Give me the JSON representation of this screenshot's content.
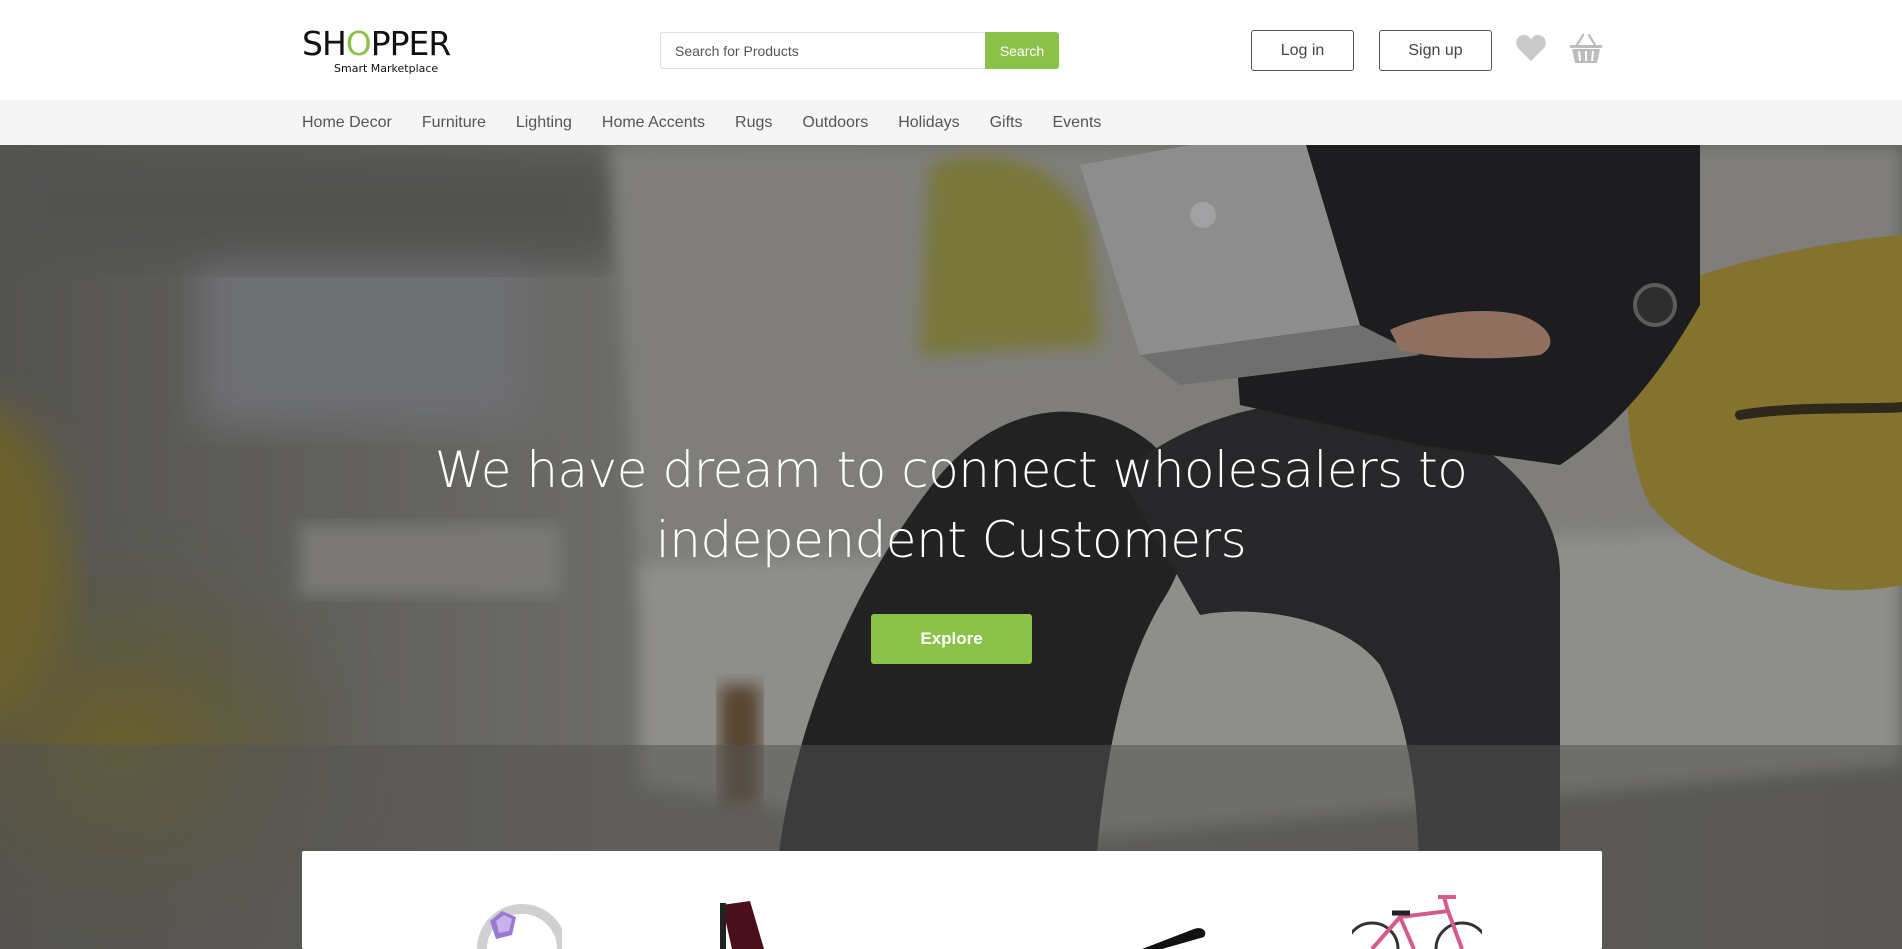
{
  "brand": {
    "name_before": "SH",
    "name_accent": "O",
    "name_after": "PPER",
    "tagline": "Smart Marketplace",
    "accent_color": "#8bc34a"
  },
  "search": {
    "placeholder": "Search for Products",
    "value": "",
    "button_label": "Search"
  },
  "account": {
    "login_label": "Log in",
    "signup_label": "Sign up",
    "wishlist_icon": "heart-icon",
    "cart_icon": "basket-icon"
  },
  "nav": {
    "items": [
      {
        "label": "Home Decor"
      },
      {
        "label": "Furniture"
      },
      {
        "label": "Lighting"
      },
      {
        "label": "Home Accents"
      },
      {
        "label": "Rugs"
      },
      {
        "label": "Outdoors"
      },
      {
        "label": "Holidays"
      },
      {
        "label": "Gifts"
      },
      {
        "label": "Events"
      }
    ]
  },
  "hero": {
    "title_line1": "We have dream to connect wholesalers to",
    "title_line2": "independent Customers",
    "cta_label": "Explore"
  },
  "products": {
    "thumbnails": [
      {
        "icon": "ring-icon"
      },
      {
        "icon": "chair-icon"
      },
      {
        "icon": "flashlight-icon"
      },
      {
        "icon": "bicycle-icon"
      }
    ]
  }
}
